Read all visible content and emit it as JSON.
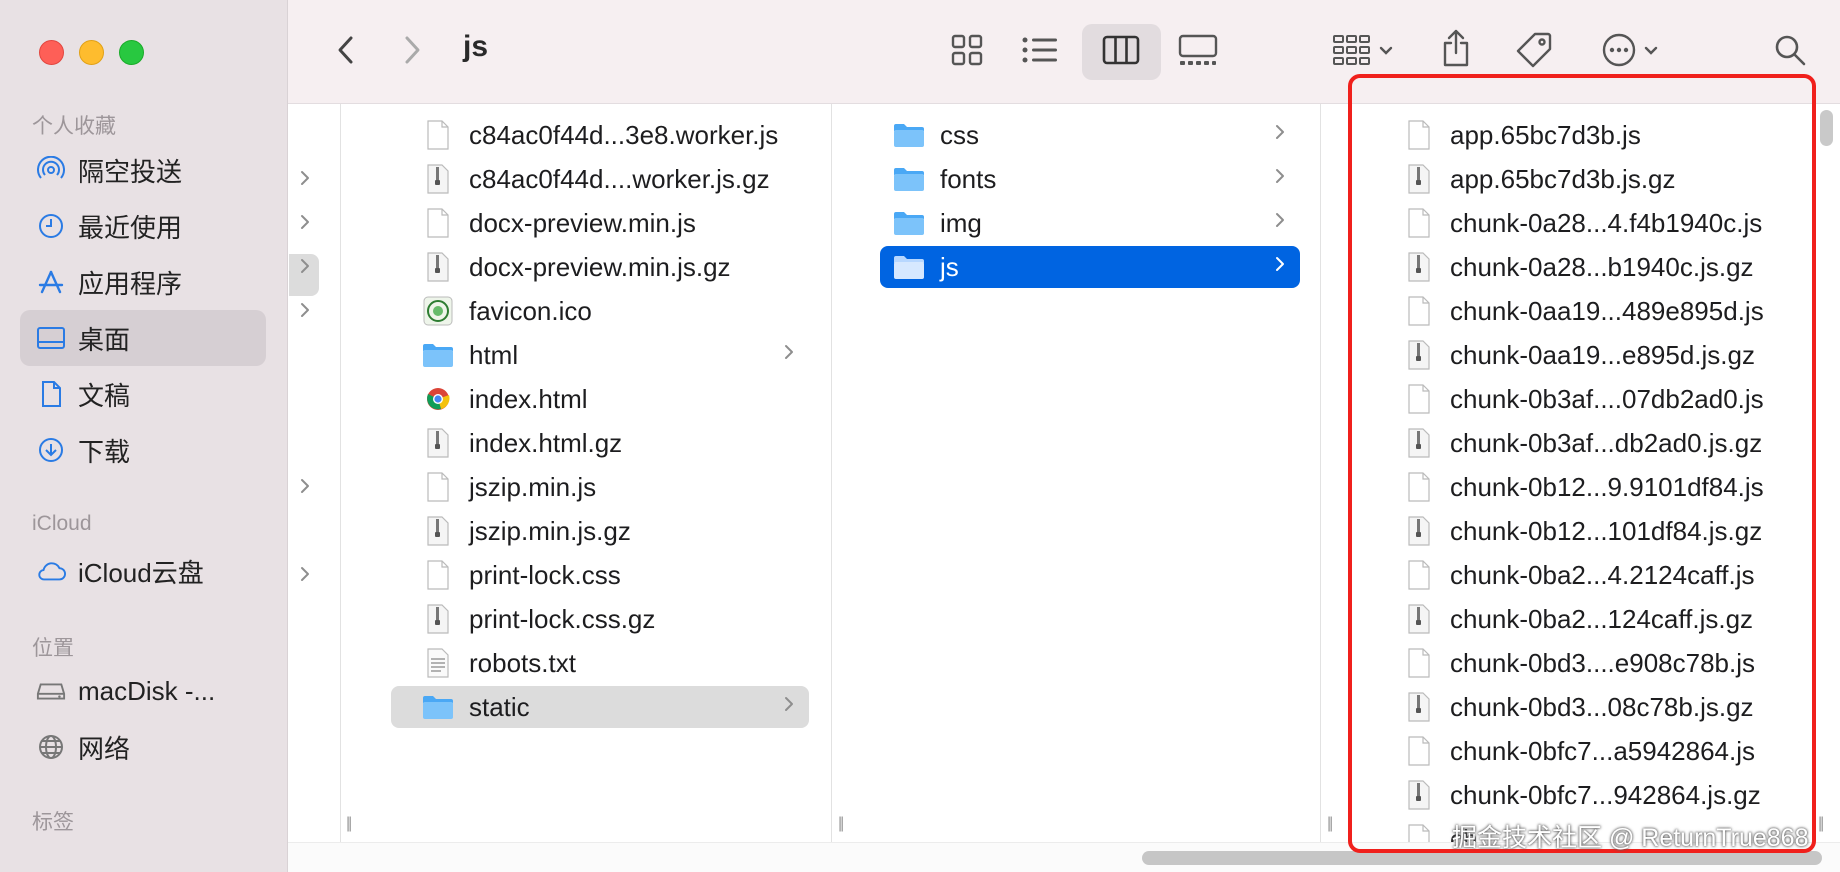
{
  "window": {
    "title": "js"
  },
  "sidebar": {
    "sections": [
      {
        "label": "个人收藏",
        "items": [
          {
            "label": "隔空投送",
            "icon": "airdrop-icon"
          },
          {
            "label": "最近使用",
            "icon": "clock-icon"
          },
          {
            "label": "应用程序",
            "icon": "applications-icon"
          },
          {
            "label": "桌面",
            "icon": "desktop-icon",
            "selected": true
          },
          {
            "label": "文稿",
            "icon": "document-icon"
          },
          {
            "label": "下载",
            "icon": "download-icon"
          }
        ]
      },
      {
        "label": "iCloud",
        "items": [
          {
            "label": "iCloud云盘",
            "icon": "icloud-icon"
          }
        ]
      },
      {
        "label": "位置",
        "items": [
          {
            "label": "macDisk -...",
            "icon": "disk-icon"
          },
          {
            "label": "网络",
            "icon": "network-icon"
          }
        ]
      },
      {
        "label": "标签",
        "items": []
      }
    ]
  },
  "toolbar": {
    "icons": [
      "back-icon",
      "forward-icon",
      "icon-view-icon",
      "list-view-icon",
      "column-view-icon",
      "gallery-view-icon",
      "group-icon",
      "share-icon",
      "tag-icon",
      "more-icon",
      "search-icon"
    ],
    "active_view": "column-view-icon"
  },
  "columns": {
    "col2": {
      "items": [
        {
          "name": "c84ac0f44d...3e8.worker.js",
          "type": "file"
        },
        {
          "name": "c84ac0f44d....worker.js.gz",
          "type": "zip"
        },
        {
          "name": "docx-preview.min.js",
          "type": "file"
        },
        {
          "name": "docx-preview.min.js.gz",
          "type": "zip"
        },
        {
          "name": "favicon.ico",
          "type": "ico"
        },
        {
          "name": "html",
          "type": "folder"
        },
        {
          "name": "index.html",
          "type": "html"
        },
        {
          "name": "index.html.gz",
          "type": "zip"
        },
        {
          "name": "jszip.min.js",
          "type": "file"
        },
        {
          "name": "jszip.min.js.gz",
          "type": "zip"
        },
        {
          "name": "print-lock.css",
          "type": "file"
        },
        {
          "name": "print-lock.css.gz",
          "type": "zip"
        },
        {
          "name": "robots.txt",
          "type": "txt"
        },
        {
          "name": "static",
          "type": "folder",
          "selected": "gray"
        }
      ]
    },
    "col3": {
      "items": [
        {
          "name": "css",
          "type": "folder"
        },
        {
          "name": "fonts",
          "type": "folder"
        },
        {
          "name": "img",
          "type": "folder"
        },
        {
          "name": "js",
          "type": "folder",
          "selected": "blue"
        }
      ]
    },
    "col4": {
      "items": [
        {
          "name": "app.65bc7d3b.js",
          "type": "file"
        },
        {
          "name": "app.65bc7d3b.js.gz",
          "type": "zip"
        },
        {
          "name": "chunk-0a28...4.f4b1940c.js",
          "type": "file"
        },
        {
          "name": "chunk-0a28...b1940c.js.gz",
          "type": "zip"
        },
        {
          "name": "chunk-0aa19...489e895d.js",
          "type": "file"
        },
        {
          "name": "chunk-0aa19...e895d.js.gz",
          "type": "zip"
        },
        {
          "name": "chunk-0b3af....07db2ad0.js",
          "type": "file"
        },
        {
          "name": "chunk-0b3af...db2ad0.js.gz",
          "type": "zip"
        },
        {
          "name": "chunk-0b12...9.9101df84.js",
          "type": "file"
        },
        {
          "name": "chunk-0b12...101df84.js.gz",
          "type": "zip"
        },
        {
          "name": "chunk-0ba2...4.2124caff.js",
          "type": "file"
        },
        {
          "name": "chunk-0ba2...124caff.js.gz",
          "type": "zip"
        },
        {
          "name": "chunk-0bd3....e908c78b.js",
          "type": "file"
        },
        {
          "name": "chunk-0bd3...08c78b.js.gz",
          "type": "zip"
        },
        {
          "name": "chunk-0bfc7...a5942864.js",
          "type": "file"
        },
        {
          "name": "chunk-0bfc7...942864.js.gz",
          "type": "zip"
        },
        {
          "name": "ch",
          "type": "file"
        }
      ]
    }
  },
  "watermark": "掘金技术社区 @ ReturnTrue868",
  "colors": {
    "selection_blue": "#0064e1",
    "highlight": "#f0201c",
    "sidebar_bg": "#e8e1e4"
  }
}
